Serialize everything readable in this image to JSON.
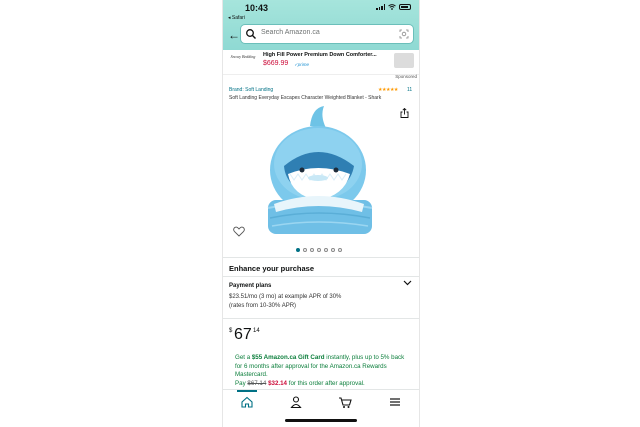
{
  "status_bar": {
    "time": "10:43",
    "back_app": "◂ Safari"
  },
  "search": {
    "placeholder": "Search Amazon.ca"
  },
  "ad": {
    "logo_text": "Snowy Bedding",
    "title": "High Fill Power Premium Down Comforter...",
    "price": "$669.99",
    "prime": "✓prime",
    "sponsored": "Sponsored"
  },
  "product": {
    "brand": "Brand: Soft Landing",
    "rating_stars": "★★★★★",
    "rating_count": "11",
    "title": "Soft Landing Everyday Escapes Character Weighted Blanket - Shark",
    "image_count": 7,
    "active_image_index": 0
  },
  "enhance": {
    "heading": "Enhance your purchase",
    "payment_title": "Payment plans",
    "payment_line1": "$23.51/mo (3 mo) at example APR of 30%",
    "payment_line2": "(rates from 10-30% APR)"
  },
  "price": {
    "currency": "$",
    "whole": "67",
    "fraction": "14"
  },
  "gift_offer": {
    "part1": "Get a ",
    "gift_amount": "$55 Amazon.ca Gift Card",
    "part2": " instantly, plus up to 5% back for 6 months after approval for the Amazon.ca Rewards Mastercard.",
    "pay_label": "Pay ",
    "old_price": "$67.14",
    "new_price": "$32.14",
    "part3": " for this order after approval."
  },
  "colors": {
    "header_teal": "#9fe0d8",
    "link": "#007185",
    "deal_red": "#cc0c39",
    "offer_green": "#0b7e3b",
    "star_orange": "#ff9900"
  },
  "nav": {
    "items": [
      "home-icon",
      "account-icon",
      "cart-icon",
      "menu-icon"
    ],
    "active": "home-icon"
  }
}
